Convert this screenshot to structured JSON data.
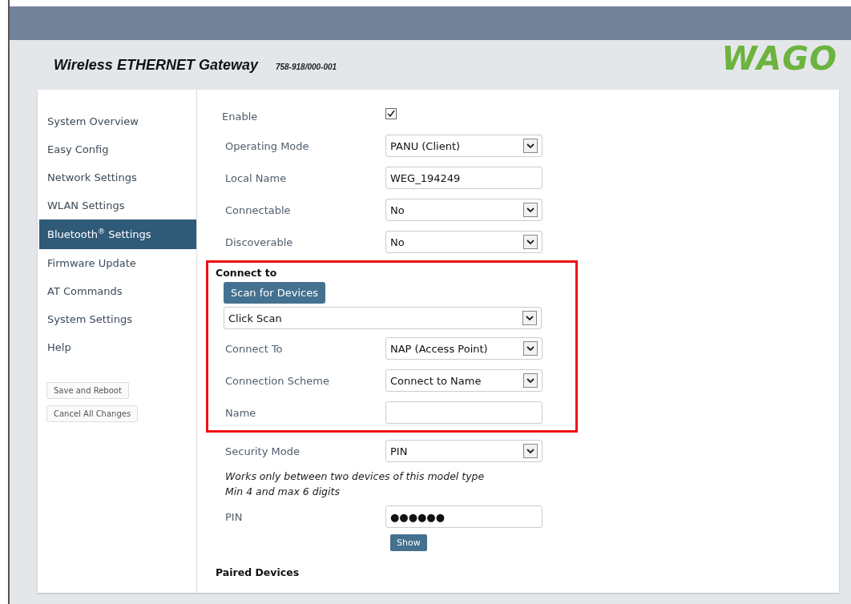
{
  "header": {
    "title": "Wireless ETHERNET Gateway",
    "model": "758-918/000-001",
    "logo": "WAGO"
  },
  "sidebar": {
    "items": [
      {
        "label": "System Overview",
        "selected": false
      },
      {
        "label": "Easy Config",
        "selected": false
      },
      {
        "label": "Network Settings",
        "selected": false
      },
      {
        "label": "WLAN Settings",
        "selected": false
      },
      {
        "label": "Bluetooth$^{®}$ Settings",
        "selected": true
      },
      {
        "label": "Firmware Update",
        "selected": false
      },
      {
        "label": "AT Commands",
        "selected": false
      },
      {
        "label": "System Settings",
        "selected": false
      },
      {
        "label": "Help",
        "selected": false
      }
    ],
    "buttons": [
      "Save and Reboot",
      "Cancel All Changes"
    ]
  },
  "form": {
    "sections": [
      {
        "kind": "plain",
        "rows": [
          {
            "kind": "checkbox",
            "label": "Enable",
            "checked": true
          },
          {
            "kind": "select",
            "label": "Operating Mode",
            "value": "PANU (Client)"
          },
          {
            "kind": "input",
            "label": "Local Name",
            "value": "WEG_194249"
          },
          {
            "kind": "select",
            "label": "Connectable",
            "value": "No"
          },
          {
            "kind": "select",
            "label": "Discoverable",
            "value": "No"
          }
        ]
      },
      {
        "kind": "highlighted",
        "rows": [
          {
            "kind": "heading",
            "text": "Connect to"
          },
          {
            "kind": "button",
            "label": "Scan for Devices"
          },
          {
            "kind": "wide_select",
            "value": "Click Scan"
          },
          {
            "kind": "select",
            "label": "Connect To",
            "value": "NAP (Access Point)"
          },
          {
            "kind": "select",
            "label": "Connection Scheme",
            "value": "Connect to Name"
          },
          {
            "kind": "input",
            "label": "Name"
          }
        ]
      },
      {
        "kind": "plain",
        "rows": [
          {
            "kind": "select",
            "label": "Security Mode",
            "value": "PIN"
          },
          {
            "kind": "note",
            "lines": [
              "Works only between two devices of this model type",
              "Min 4 and max 6 digits"
            ]
          },
          {
            "kind": "password",
            "label": "PIN",
            "value": "●●●●●●"
          },
          {
            "kind": "small_button",
            "label": "Show"
          },
          {
            "kind": "heading",
            "text": "Paired Devices"
          }
        ]
      }
    ]
  }
}
